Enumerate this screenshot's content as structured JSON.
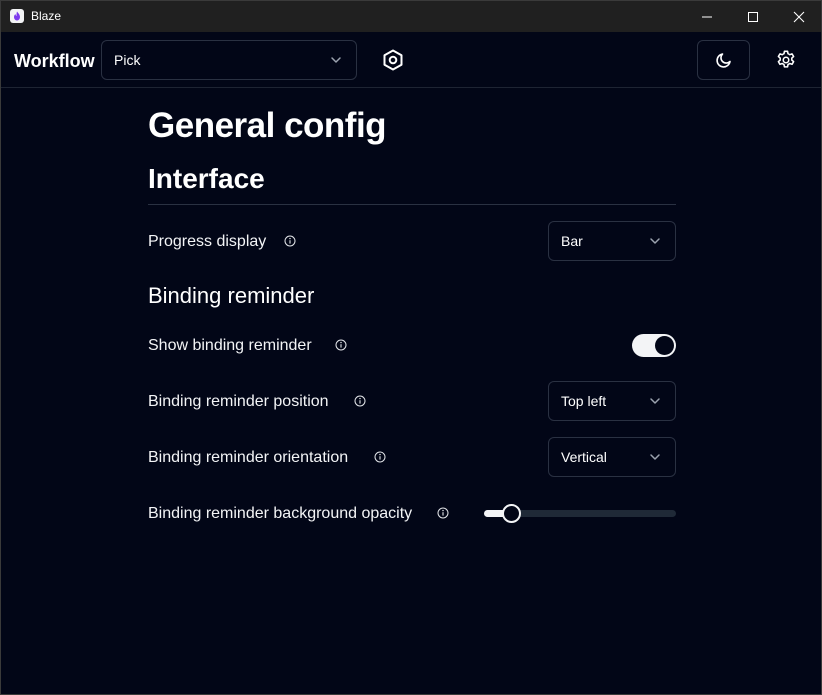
{
  "window": {
    "title": "Blaze"
  },
  "header": {
    "brand": "Workflow",
    "workflow_select": {
      "value": "Pick"
    }
  },
  "page": {
    "title": "General config",
    "sections": {
      "interface": {
        "title": "Interface",
        "progress_display": {
          "label": "Progress display",
          "value": "Bar"
        }
      },
      "binding_reminder": {
        "title": "Binding reminder",
        "show": {
          "label": "Show binding reminder",
          "enabled": true
        },
        "position": {
          "label": "Binding reminder position",
          "value": "Top left"
        },
        "orientation": {
          "label": "Binding reminder orientation",
          "value": "Vertical"
        },
        "opacity": {
          "label": "Binding reminder background opacity",
          "value_fraction": 0.1
        }
      }
    }
  },
  "colors": {
    "background": "#020617",
    "titlebar": "#202020",
    "accent": "#f3f4f6",
    "border": "#2a3142",
    "app_icon_flame": "#7c3aed"
  },
  "icons": {
    "app": "flame-icon",
    "minimize": "minimize-icon",
    "maximize": "maximize-icon",
    "close": "close-icon",
    "chevron": "chevron-down-icon",
    "hexagon": "hexagon-icon",
    "theme": "moon-icon",
    "settings": "gear-icon",
    "info": "info-icon"
  }
}
